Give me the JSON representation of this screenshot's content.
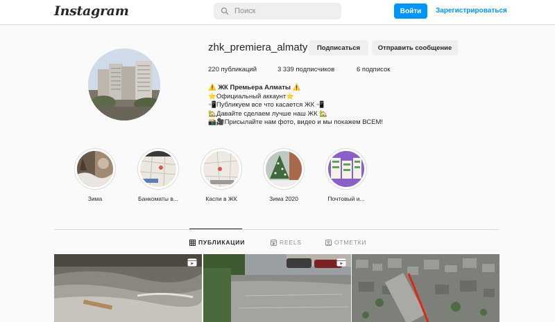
{
  "header": {
    "logo": "Instagram",
    "search_placeholder": "Поиск",
    "login_label": "Войти",
    "register_label": "Зарегистрироваться"
  },
  "profile": {
    "username": "zhk_premiera_almaty",
    "follow_label": "Подписаться",
    "message_label": "Отправить сообщение",
    "stats": {
      "posts": "220 публикаций",
      "followers": "3 339 подписчиков",
      "following": "6 подписок"
    },
    "bio": {
      "name": "⚠️ ЖК Премьера Алматы ⚠️",
      "lines": [
        "⭐Официальный аккаунт⭐",
        "📲Публикуем все что касается ЖК 📲",
        "🏡Давайте сделаем лучше наш ЖК 🏡",
        "📸🎥Присылайте нам фото, видео и мы покажем ВСЕМ!"
      ]
    }
  },
  "highlights": [
    {
      "label": "Зима"
    },
    {
      "label": "Банкоматы в..."
    },
    {
      "label": "Каспи в ЖК"
    },
    {
      "label": "Зима 2020"
    },
    {
      "label": "Почтовый и..."
    }
  ],
  "tabs": [
    {
      "label": "ПУБЛИКАЦИИ",
      "icon": "grid-icon",
      "active": true
    },
    {
      "label": "REELS",
      "icon": "reels-icon",
      "active": false
    },
    {
      "label": "ОТМЕТКИ",
      "icon": "tagged-icon",
      "active": false
    }
  ],
  "posts": [
    {
      "type": "video",
      "icon": "video-icon"
    },
    {
      "type": "video",
      "icon": "video-icon"
    },
    {
      "type": "image"
    }
  ],
  "colors": {
    "accent": "#0095f6",
    "background": "#fafafa",
    "border": "#dbdbdb"
  }
}
